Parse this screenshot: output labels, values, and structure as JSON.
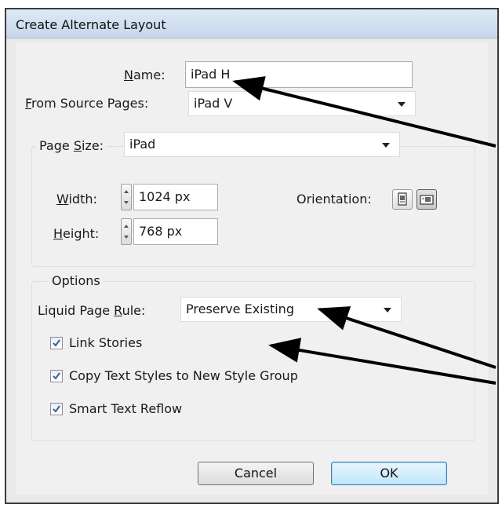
{
  "window": {
    "title": "Create Alternate Layout"
  },
  "name_field": {
    "label": "Name:",
    "value": "iPad H"
  },
  "source_pages": {
    "label": "From Source Pages:",
    "value": "iPad V"
  },
  "page_size": {
    "label": "Page Size:",
    "value": "iPad",
    "width": {
      "label": "Width:",
      "value": "1024 px"
    },
    "height": {
      "label": "Height:",
      "value": "768 px"
    },
    "orientation_label": "Orientation:"
  },
  "options": {
    "legend": "Options",
    "liquid_rule": {
      "label": "Liquid Page Rule:",
      "value": "Preserve Existing"
    },
    "checkboxes": [
      {
        "label": "Link Stories",
        "checked": true
      },
      {
        "label": "Copy Text Styles to New Style Group",
        "checked": true
      },
      {
        "label": "Smart Text Reflow",
        "checked": true
      }
    ]
  },
  "buttons": {
    "cancel": "Cancel",
    "ok": "OK"
  },
  "icons": {
    "portrait": "portrait-orientation-icon",
    "landscape": "landscape-orientation-icon",
    "check": "checkmark-icon",
    "dropdown": "chevron-down-icon",
    "spinner": "spinner-icon"
  },
  "colors": {
    "title_bar": "#c6d7ec",
    "ok_button": "#bee6fd",
    "annotation_arrow": "#000000"
  }
}
